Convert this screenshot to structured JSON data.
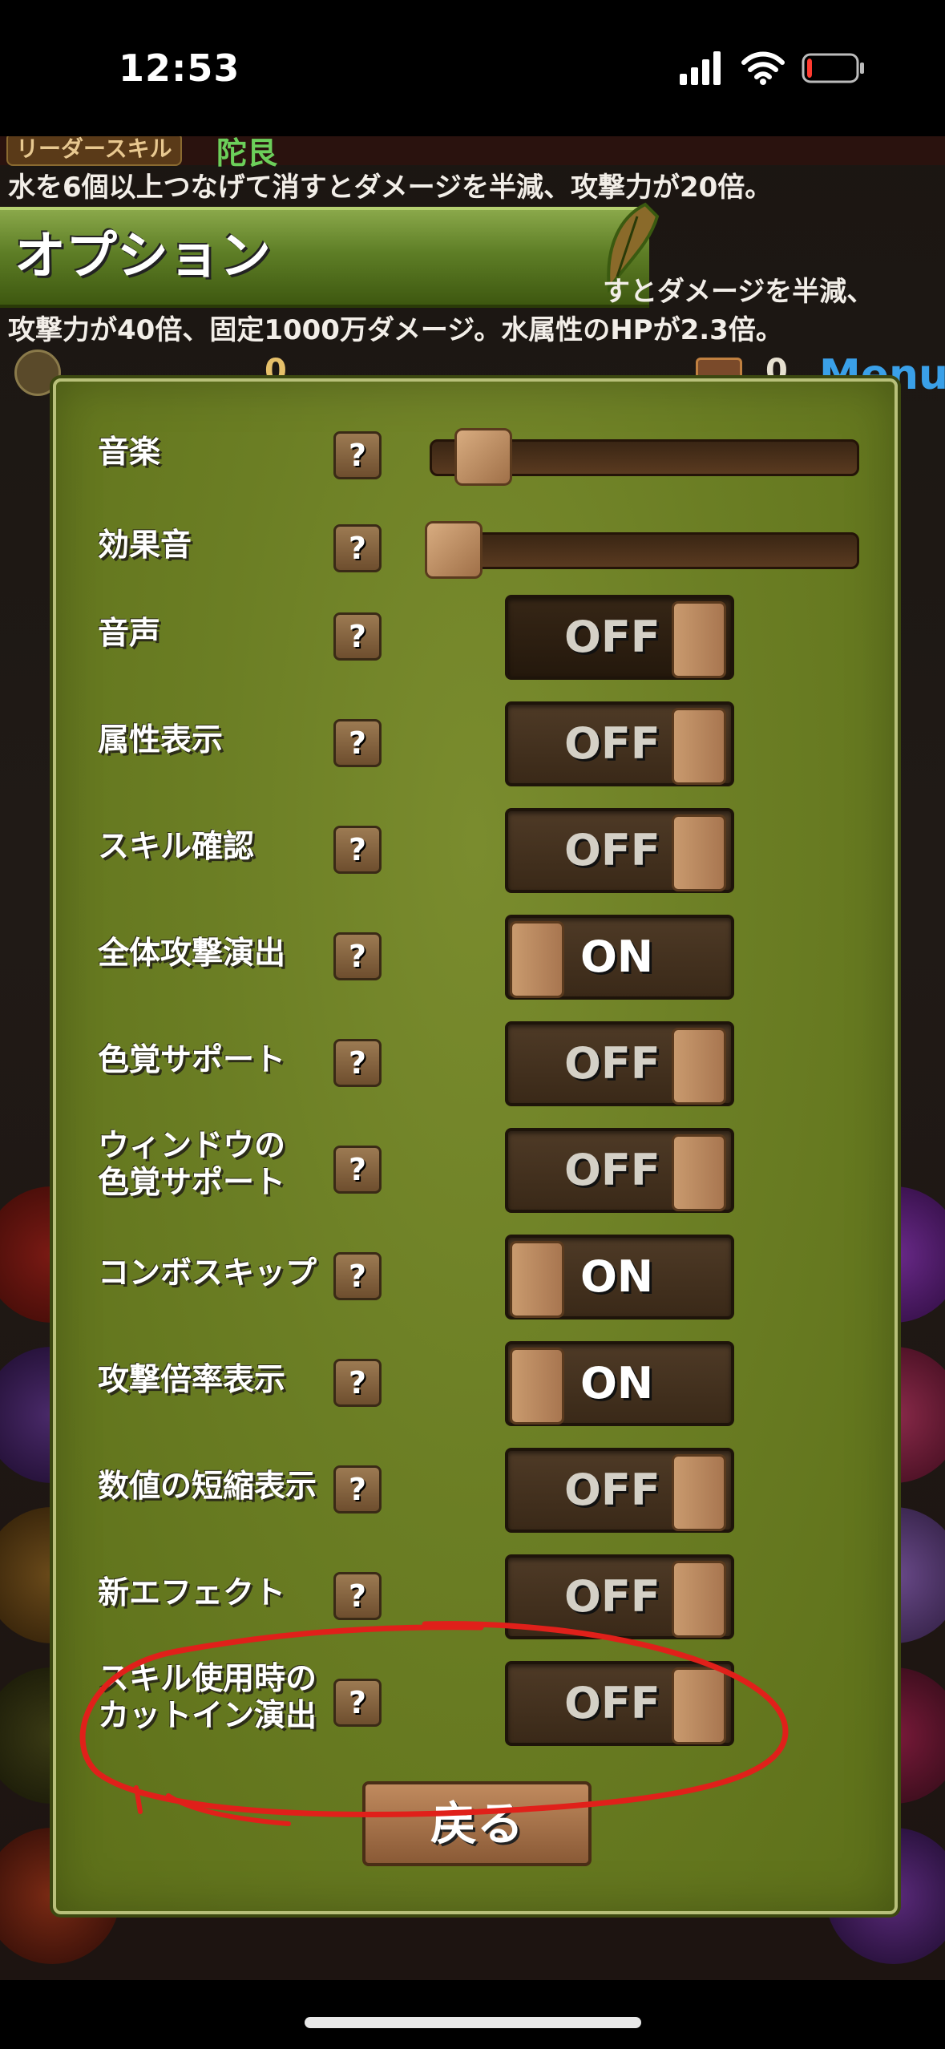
{
  "status_bar": {
    "time": "12:53",
    "battery_level": 0.1
  },
  "game_background": {
    "leader_skill_label": "リーダースキル",
    "leader_skill_name": "陀艮",
    "skill_line_1": "水を6個以上つなげて消すとダメージを半減、攻撃力が20倍。",
    "skill_line_2": "すとダメージを半減、",
    "skill_line_3": "攻撃力が40倍、固定1000万ダメージ。水属性のHPが2.3倍。",
    "left_counter": "0",
    "right_counter": "0",
    "menu_label": "Menu"
  },
  "options": {
    "title": "オプション",
    "help_glyph": "?",
    "sliders": [
      {
        "label": "音楽",
        "level": 0.08
      },
      {
        "label": "効果音",
        "level": 0.0
      }
    ],
    "toggles": [
      {
        "label": "音声",
        "state": "OFF"
      },
      {
        "label": "属性表示",
        "state": "OFF"
      },
      {
        "label": "スキル確認",
        "state": "OFF"
      },
      {
        "label": "全体攻撃演出",
        "state": "ON"
      },
      {
        "label": "色覚サポート",
        "state": "OFF"
      },
      {
        "label": "ウィンドウの\n色覚サポート",
        "state": "OFF"
      },
      {
        "label": "コンボスキップ",
        "state": "ON"
      },
      {
        "label": "攻撃倍率表示",
        "state": "ON"
      },
      {
        "label": "数値の短縮表示",
        "state": "OFF"
      },
      {
        "label": "新エフェクト",
        "state": "OFF"
      },
      {
        "label": "スキル使用時の\nカットイン演出",
        "state": "OFF"
      }
    ],
    "back_label": "戻る"
  },
  "colors": {
    "panel": "#6b7e24",
    "header": "#5e7e26",
    "annotation": "#e0201a",
    "menu": "#3aa0e8"
  }
}
